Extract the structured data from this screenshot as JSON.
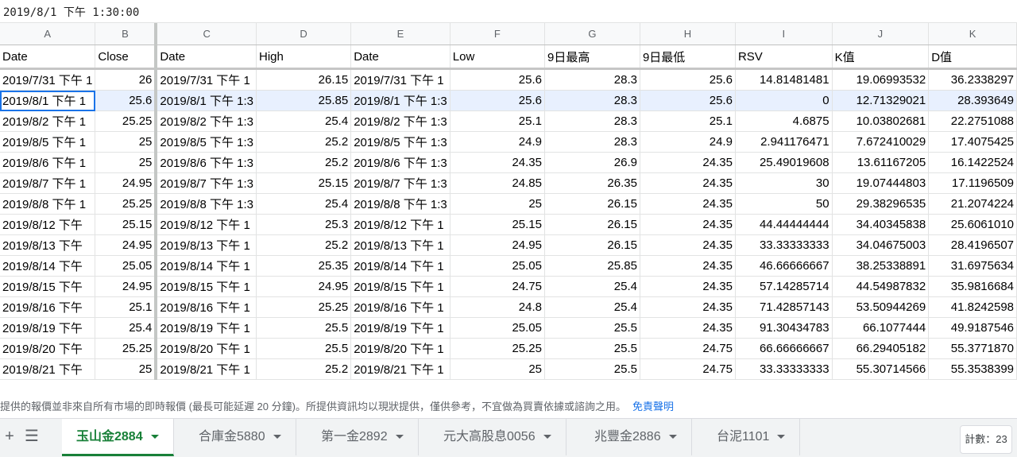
{
  "formula_bar": {
    "value": "2019/8/1 下午 1:30:00"
  },
  "columns": [
    "A",
    "B",
    "C",
    "D",
    "E",
    "F",
    "G",
    "H",
    "I",
    "J",
    "K"
  ],
  "headers": [
    "Date",
    "Close",
    "Date",
    "High",
    "Date",
    "Low",
    "9日最高",
    "9日最低",
    "RSV",
    "K值",
    "D值"
  ],
  "rows": [
    [
      "2019/7/31 下午 1",
      "26",
      "2019/7/31 下午 1",
      "26.15",
      "2019/7/31 下午 1",
      "25.6",
      "28.3",
      "25.6",
      "14.81481481",
      "19.06993532",
      "36.2338297"
    ],
    [
      "2019/8/1 下午 1",
      "25.6",
      "2019/8/1 下午 1:3",
      "25.85",
      "2019/8/1 下午 1:3",
      "25.6",
      "28.3",
      "25.6",
      "0",
      "12.71329021",
      "28.393649"
    ],
    [
      "2019/8/2 下午 1",
      "25.25",
      "2019/8/2 下午 1:3",
      "25.4",
      "2019/8/2 下午 1:3",
      "25.1",
      "28.3",
      "25.1",
      "4.6875",
      "10.03802681",
      "22.2751088"
    ],
    [
      "2019/8/5 下午 1",
      "25",
      "2019/8/5 下午 1:3",
      "25.2",
      "2019/8/5 下午 1:3",
      "24.9",
      "28.3",
      "24.9",
      "2.941176471",
      "7.672410029",
      "17.4075425"
    ],
    [
      "2019/8/6 下午 1",
      "25",
      "2019/8/6 下午 1:3",
      "25.2",
      "2019/8/6 下午 1:3",
      "24.35",
      "26.9",
      "24.35",
      "25.49019608",
      "13.61167205",
      "16.1422524"
    ],
    [
      "2019/8/7 下午 1",
      "24.95",
      "2019/8/7 下午 1:3",
      "25.15",
      "2019/8/7 下午 1:3",
      "24.85",
      "26.35",
      "24.35",
      "30",
      "19.07444803",
      "17.1196509"
    ],
    [
      "2019/8/8 下午 1",
      "25.25",
      "2019/8/8 下午 1:3",
      "25.4",
      "2019/8/8 下午 1:3",
      "25",
      "26.15",
      "24.35",
      "50",
      "29.38296535",
      "21.2074224"
    ],
    [
      "2019/8/12 下午",
      "25.15",
      "2019/8/12 下午 1",
      "25.3",
      "2019/8/12 下午 1",
      "25.15",
      "26.15",
      "24.35",
      "44.44444444",
      "34.40345838",
      "25.6061010"
    ],
    [
      "2019/8/13 下午",
      "24.95",
      "2019/8/13 下午 1",
      "25.2",
      "2019/8/13 下午 1",
      "24.95",
      "26.15",
      "24.35",
      "33.33333333",
      "34.04675003",
      "28.4196507"
    ],
    [
      "2019/8/14 下午",
      "25.05",
      "2019/8/14 下午 1",
      "25.35",
      "2019/8/14 下午 1",
      "25.05",
      "25.85",
      "24.35",
      "46.66666667",
      "38.25338891",
      "31.6975634"
    ],
    [
      "2019/8/15 下午",
      "24.95",
      "2019/8/15 下午 1",
      "24.95",
      "2019/8/15 下午 1",
      "24.75",
      "25.4",
      "24.35",
      "57.14285714",
      "44.54987832",
      "35.9816684"
    ],
    [
      "2019/8/16 下午",
      "25.1",
      "2019/8/16 下午 1",
      "25.25",
      "2019/8/16 下午 1",
      "24.8",
      "25.4",
      "24.35",
      "71.42857143",
      "53.50944269",
      "41.8242598"
    ],
    [
      "2019/8/19 下午",
      "25.4",
      "2019/8/19 下午 1",
      "25.5",
      "2019/8/19 下午 1",
      "25.05",
      "25.5",
      "24.35",
      "91.30434783",
      "66.1077444",
      "49.9187546"
    ],
    [
      "2019/8/20 下午",
      "25.25",
      "2019/8/20 下午 1",
      "25.5",
      "2019/8/20 下午 1",
      "25.25",
      "25.5",
      "24.75",
      "66.66666667",
      "66.29405182",
      "55.3771870"
    ],
    [
      "2019/8/21 下午",
      "25",
      "2019/8/21 下午 1",
      "25.2",
      "2019/8/21 下午 1",
      "25",
      "25.5",
      "24.75",
      "33.33333333",
      "55.30714566",
      "55.3538399"
    ]
  ],
  "disclaimer": {
    "text": "提供的報價並非來自所有市場的即時報價 (最長可能延遲 20 分鐘)。所提供資訊均以現狀提供，僅供參考，不宜做為買賣依據或諮詢之用。",
    "link": "免責聲明"
  },
  "tabs": [
    "玉山金2884",
    "合庫金5880",
    "第一金2892",
    "元大高股息0056",
    "兆豐金2886",
    "台泥1101"
  ],
  "status": {
    "count_label": "計數：23"
  },
  "colors": {
    "accent": "#188038",
    "selection": "#1a73e8"
  }
}
